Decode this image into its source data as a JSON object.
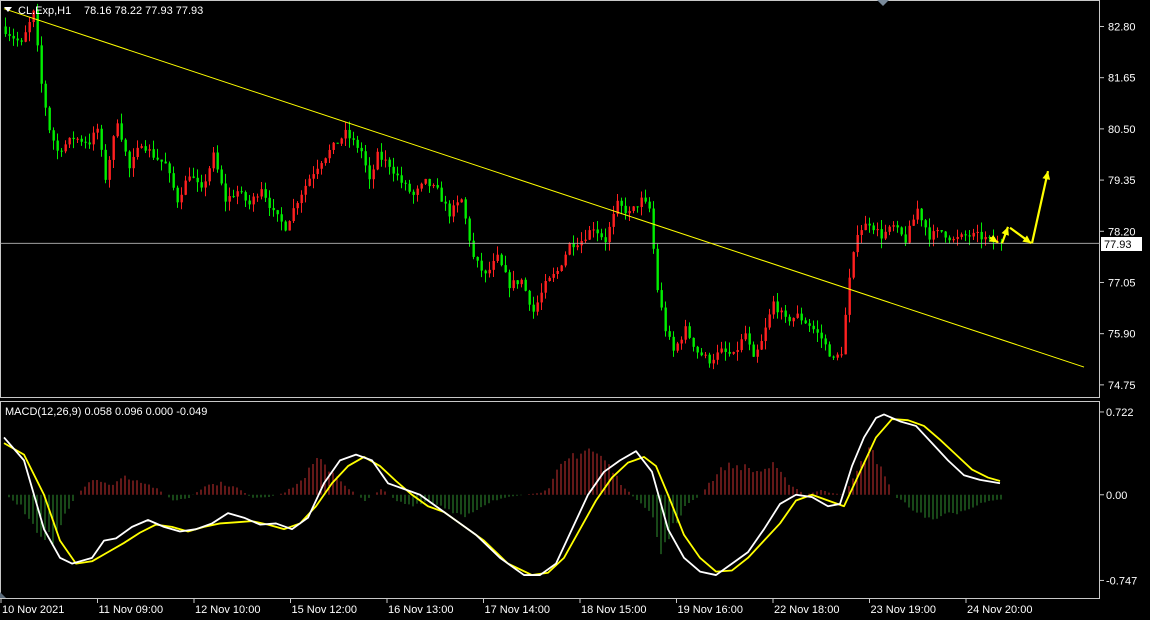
{
  "header": {
    "symbol": "CL.Exp,H1",
    "ohlc": "78.16 78.22 77.93 77.93"
  },
  "colors": {
    "background": "#000000",
    "frame": "#c8c8c8",
    "text": "#ffffff",
    "bull": "#ff2020",
    "bear": "#00ee00",
    "trendline": "#ffff00",
    "macd_line": "#ffffff",
    "signal_line": "#ffff00",
    "hist_pos": "#c83030",
    "hist_neg": "#2f8f2f",
    "forecast": "#ffff00"
  },
  "chart_data": [
    {
      "type": "candlestick",
      "name": "price",
      "ylim": [
        74.5,
        83.35
      ],
      "y_ticks": [
        "82.80",
        "81.65",
        "80.50",
        "79.35",
        "78.20",
        "77.05",
        "75.90",
        "74.75"
      ],
      "current_price": "77.93",
      "x_ticks": [
        "10 Nov 2021",
        "11 Nov 09:00",
        "12 Nov 10:00",
        "15 Nov 12:00",
        "16 Nov 13:00",
        "17 Nov 14:00",
        "18 Nov 15:00",
        "19 Nov 16:00",
        "22 Nov 18:00",
        "23 Nov 19:00",
        "24 Nov 20:00"
      ],
      "path_points": [
        [
          0,
          82.8
        ],
        [
          5,
          82.4
        ],
        [
          8,
          83.1
        ],
        [
          10,
          81.5
        ],
        [
          12,
          80.5
        ],
        [
          14,
          80.0
        ],
        [
          18,
          80.3
        ],
        [
          22,
          80.2
        ],
        [
          24,
          80.5
        ],
        [
          26,
          79.4
        ],
        [
          29,
          80.7
        ],
        [
          32,
          79.6
        ],
        [
          35,
          80.2
        ],
        [
          38,
          79.9
        ],
        [
          41,
          79.7
        ],
        [
          44,
          78.9
        ],
        [
          47,
          79.5
        ],
        [
          50,
          79.1
        ],
        [
          53,
          79.9
        ],
        [
          56,
          78.9
        ],
        [
          59,
          79.1
        ],
        [
          62,
          78.8
        ],
        [
          65,
          79.2
        ],
        [
          68,
          78.6
        ],
        [
          71,
          78.3
        ],
        [
          74,
          78.9
        ],
        [
          77,
          79.4
        ],
        [
          80,
          79.8
        ],
        [
          83,
          80.1
        ],
        [
          86,
          80.4
        ],
        [
          88,
          80.2
        ],
        [
          90,
          80.0
        ],
        [
          92,
          79.3
        ],
        [
          94,
          79.9
        ],
        [
          97,
          79.7
        ],
        [
          100,
          79.3
        ],
        [
          103,
          79.0
        ],
        [
          106,
          79.3
        ],
        [
          109,
          79.1
        ],
        [
          112,
          78.6
        ],
        [
          115,
          78.9
        ],
        [
          118,
          77.6
        ],
        [
          121,
          77.2
        ],
        [
          124,
          77.6
        ],
        [
          127,
          77.0
        ],
        [
          130,
          77.1
        ],
        [
          133,
          76.4
        ],
        [
          136,
          77.0
        ],
        [
          139,
          77.3
        ],
        [
          142,
          77.9
        ],
        [
          145,
          78.0
        ],
        [
          148,
          78.3
        ],
        [
          151,
          78.0
        ],
        [
          154,
          78.8
        ],
        [
          157,
          78.6
        ],
        [
          160,
          78.9
        ],
        [
          162,
          78.7
        ],
        [
          164,
          76.9
        ],
        [
          166,
          76.0
        ],
        [
          168,
          75.5
        ],
        [
          171,
          76.0
        ],
        [
          174,
          75.5
        ],
        [
          177,
          75.3
        ],
        [
          180,
          75.5
        ],
        [
          183,
          75.4
        ],
        [
          186,
          75.9
        ],
        [
          188,
          75.3
        ],
        [
          190,
          75.7
        ],
        [
          193,
          76.6
        ],
        [
          196,
          76.2
        ],
        [
          199,
          76.3
        ],
        [
          202,
          76.1
        ],
        [
          205,
          75.8
        ],
        [
          208,
          75.3
        ],
        [
          210,
          75.5
        ],
        [
          212,
          77.1
        ],
        [
          214,
          78.2
        ],
        [
          217,
          78.4
        ],
        [
          220,
          78.1
        ],
        [
          223,
          78.3
        ],
        [
          226,
          78.0
        ],
        [
          229,
          78.7
        ],
        [
          232,
          78.1
        ],
        [
          235,
          78.2
        ],
        [
          238,
          78.0
        ],
        [
          241,
          78.1
        ],
        [
          244,
          78.1
        ],
        [
          247,
          78.0
        ],
        [
          249,
          77.93
        ]
      ],
      "trendline": [
        [
          0,
          83.2
        ],
        [
          270,
          75.15
        ]
      ],
      "forecast_arrows": [
        [
          [
            246.5,
            78.06
          ],
          [
            248.5,
            77.95
          ]
        ],
        [
          [
            249.5,
            77.93
          ],
          [
            251.0,
            78.3
          ]
        ],
        [
          [
            251.5,
            78.28
          ],
          [
            256.8,
            77.93
          ]
        ],
        [
          [
            257.0,
            77.93
          ],
          [
            261.0,
            79.55
          ]
        ]
      ]
    },
    {
      "type": "macd",
      "label": "MACD(12,26,9) 0.058 0.096 0.000 -0.049",
      "ylim": [
        -0.9,
        0.8
      ],
      "y_ticks": [
        "0.722",
        "0.00",
        "-0.747"
      ],
      "macd": [
        [
          0,
          0.5
        ],
        [
          5,
          0.3
        ],
        [
          10,
          -0.3
        ],
        [
          14,
          -0.55
        ],
        [
          17,
          -0.6
        ],
        [
          22,
          -0.55
        ],
        [
          25,
          -0.4
        ],
        [
          28,
          -0.38
        ],
        [
          32,
          -0.28
        ],
        [
          36,
          -0.22
        ],
        [
          40,
          -0.28
        ],
        [
          44,
          -0.32
        ],
        [
          48,
          -0.3
        ],
        [
          52,
          -0.25
        ],
        [
          56,
          -0.16
        ],
        [
          60,
          -0.2
        ],
        [
          64,
          -0.26
        ],
        [
          68,
          -0.25
        ],
        [
          72,
          -0.3
        ],
        [
          76,
          -0.2
        ],
        [
          80,
          0.1
        ],
        [
          84,
          0.3
        ],
        [
          88,
          0.35
        ],
        [
          92,
          0.3
        ],
        [
          96,
          0.1
        ],
        [
          100,
          0.05
        ],
        [
          104,
          0.0
        ],
        [
          108,
          -0.1
        ],
        [
          112,
          -0.2
        ],
        [
          118,
          -0.35
        ],
        [
          124,
          -0.55
        ],
        [
          130,
          -0.7
        ],
        [
          134,
          -0.7
        ],
        [
          138,
          -0.6
        ],
        [
          142,
          -0.3
        ],
        [
          146,
          0.0
        ],
        [
          150,
          0.2
        ],
        [
          154,
          0.3
        ],
        [
          158,
          0.38
        ],
        [
          162,
          0.2
        ],
        [
          166,
          -0.3
        ],
        [
          170,
          -0.55
        ],
        [
          174,
          -0.67
        ],
        [
          178,
          -0.7
        ],
        [
          182,
          -0.6
        ],
        [
          186,
          -0.5
        ],
        [
          190,
          -0.3
        ],
        [
          194,
          -0.08
        ],
        [
          198,
          0.0
        ],
        [
          202,
          -0.02
        ],
        [
          206,
          -0.1
        ],
        [
          209,
          -0.08
        ],
        [
          212,
          0.25
        ],
        [
          215,
          0.5
        ],
        [
          218,
          0.67
        ],
        [
          220,
          0.7
        ],
        [
          224,
          0.64
        ],
        [
          228,
          0.6
        ],
        [
          232,
          0.45
        ],
        [
          236,
          0.3
        ],
        [
          240,
          0.17
        ],
        [
          244,
          0.13
        ],
        [
          249,
          0.1
        ]
      ],
      "signal": [
        [
          0,
          0.45
        ],
        [
          5,
          0.35
        ],
        [
          10,
          0.0
        ],
        [
          14,
          -0.4
        ],
        [
          18,
          -0.6
        ],
        [
          22,
          -0.58
        ],
        [
          26,
          -0.5
        ],
        [
          30,
          -0.42
        ],
        [
          34,
          -0.33
        ],
        [
          38,
          -0.26
        ],
        [
          42,
          -0.28
        ],
        [
          46,
          -0.32
        ],
        [
          50,
          -0.28
        ],
        [
          54,
          -0.25
        ],
        [
          58,
          -0.24
        ],
        [
          62,
          -0.23
        ],
        [
          66,
          -0.26
        ],
        [
          70,
          -0.3
        ],
        [
          74,
          -0.25
        ],
        [
          78,
          -0.1
        ],
        [
          82,
          0.1
        ],
        [
          86,
          0.25
        ],
        [
          90,
          0.33
        ],
        [
          94,
          0.25
        ],
        [
          98,
          0.12
        ],
        [
          102,
          0.0
        ],
        [
          106,
          -0.1
        ],
        [
          110,
          -0.15
        ],
        [
          114,
          -0.25
        ],
        [
          120,
          -0.4
        ],
        [
          126,
          -0.6
        ],
        [
          132,
          -0.7
        ],
        [
          136,
          -0.68
        ],
        [
          140,
          -0.55
        ],
        [
          144,
          -0.3
        ],
        [
          148,
          -0.05
        ],
        [
          152,
          0.15
        ],
        [
          156,
          0.28
        ],
        [
          160,
          0.33
        ],
        [
          163,
          0.25
        ],
        [
          166,
          0.0
        ],
        [
          170,
          -0.35
        ],
        [
          174,
          -0.55
        ],
        [
          178,
          -0.67
        ],
        [
          182,
          -0.66
        ],
        [
          186,
          -0.55
        ],
        [
          190,
          -0.4
        ],
        [
          194,
          -0.25
        ],
        [
          198,
          -0.05
        ],
        [
          202,
          0.0
        ],
        [
          206,
          -0.05
        ],
        [
          210,
          -0.1
        ],
        [
          214,
          0.2
        ],
        [
          218,
          0.5
        ],
        [
          222,
          0.66
        ],
        [
          226,
          0.65
        ],
        [
          230,
          0.6
        ],
        [
          234,
          0.48
        ],
        [
          238,
          0.35
        ],
        [
          242,
          0.22
        ],
        [
          246,
          0.15
        ],
        [
          249,
          0.12
        ]
      ],
      "histogram_envelope": [
        [
          0,
          0.0
        ],
        [
          4,
          -0.1
        ],
        [
          8,
          -0.3
        ],
        [
          12,
          -0.4
        ],
        [
          14,
          -0.25
        ],
        [
          18,
          0.0
        ],
        [
          22,
          0.15
        ],
        [
          26,
          0.08
        ],
        [
          30,
          0.16
        ],
        [
          34,
          0.12
        ],
        [
          38,
          0.05
        ],
        [
          42,
          -0.05
        ],
        [
          46,
          -0.03
        ],
        [
          50,
          0.08
        ],
        [
          54,
          0.1
        ],
        [
          58,
          0.06
        ],
        [
          62,
          -0.03
        ],
        [
          66,
          -0.02
        ],
        [
          70,
          0.02
        ],
        [
          74,
          0.12
        ],
        [
          78,
          0.3
        ],
        [
          82,
          0.2
        ],
        [
          86,
          0.05
        ],
        [
          90,
          -0.05
        ],
        [
          94,
          0.05
        ],
        [
          98,
          -0.05
        ],
        [
          102,
          -0.1
        ],
        [
          106,
          -0.06
        ],
        [
          110,
          -0.12
        ],
        [
          114,
          -0.2
        ],
        [
          118,
          -0.12
        ],
        [
          122,
          -0.05
        ],
        [
          126,
          -0.02
        ],
        [
          130,
          0.0
        ],
        [
          134,
          0.02
        ],
        [
          136,
          0.05
        ],
        [
          138,
          0.2
        ],
        [
          142,
          0.35
        ],
        [
          146,
          0.4
        ],
        [
          150,
          0.3
        ],
        [
          154,
          0.1
        ],
        [
          158,
          -0.05
        ],
        [
          162,
          -0.2
        ],
        [
          164,
          -0.5
        ],
        [
          166,
          -0.35
        ],
        [
          170,
          -0.1
        ],
        [
          174,
          0.0
        ],
        [
          176,
          0.1
        ],
        [
          180,
          0.25
        ],
        [
          184,
          0.25
        ],
        [
          188,
          0.2
        ],
        [
          192,
          0.25
        ],
        [
          196,
          0.1
        ],
        [
          200,
          0.0
        ],
        [
          204,
          0.04
        ],
        [
          206,
          0.02
        ],
        [
          210,
          0.0
        ],
        [
          213,
          0.2
        ],
        [
          216,
          0.4
        ],
        [
          219,
          0.25
        ],
        [
          222,
          0.0
        ],
        [
          226,
          -0.1
        ],
        [
          230,
          -0.2
        ],
        [
          234,
          -0.2
        ],
        [
          238,
          -0.15
        ],
        [
          242,
          -0.1
        ],
        [
          246,
          -0.05
        ],
        [
          249,
          -0.04
        ]
      ]
    }
  ]
}
